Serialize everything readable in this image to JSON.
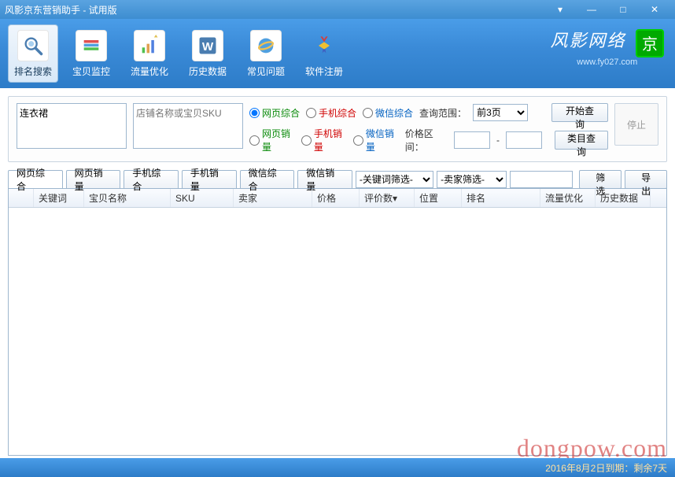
{
  "window": {
    "title": "风影京东营销助手 - 试用版"
  },
  "toolbar": {
    "items": [
      {
        "label": "排名搜索"
      },
      {
        "label": "宝贝监控"
      },
      {
        "label": "流量优化"
      },
      {
        "label": "历史数据"
      },
      {
        "label": "常见问题"
      },
      {
        "label": "软件注册"
      }
    ]
  },
  "brand": {
    "name": "风影网络",
    "url": "www.fy027.com",
    "badge": "京"
  },
  "filters": {
    "keyword_value": "连衣裙",
    "shop_placeholder": "店铺名称或宝贝SKU",
    "radios_row1": {
      "web": "网页综合",
      "mobile": "手机综合",
      "wechat": "微信综合"
    },
    "radios_row2": {
      "web": "网页销量",
      "mobile": "手机销量",
      "wechat": "微信销量"
    },
    "range_label": "查询范围：",
    "range_value": "前3页",
    "start_btn": "开始查询",
    "price_label": "价格区间：",
    "dash": "-",
    "category_btn": "类目查询",
    "stop_btn": "停止"
  },
  "tabs": {
    "items": [
      "网页综合",
      "网页销量",
      "手机综合",
      "手机销量",
      "微信综合",
      "微信销量"
    ],
    "keyword_filter": "-关键词筛选-",
    "seller_filter": "-卖家筛选-",
    "filter_btn": "筛选",
    "export_btn": "导出"
  },
  "table": {
    "columns": [
      "",
      "关键词",
      "宝贝名称",
      "SKU",
      "卖家",
      "价格",
      "评价数",
      "位置",
      "排名",
      "流量优化",
      "历史数据"
    ]
  },
  "status": {
    "text": "2016年8月2日到期：剩余7天"
  },
  "watermark": "dongpow.com"
}
